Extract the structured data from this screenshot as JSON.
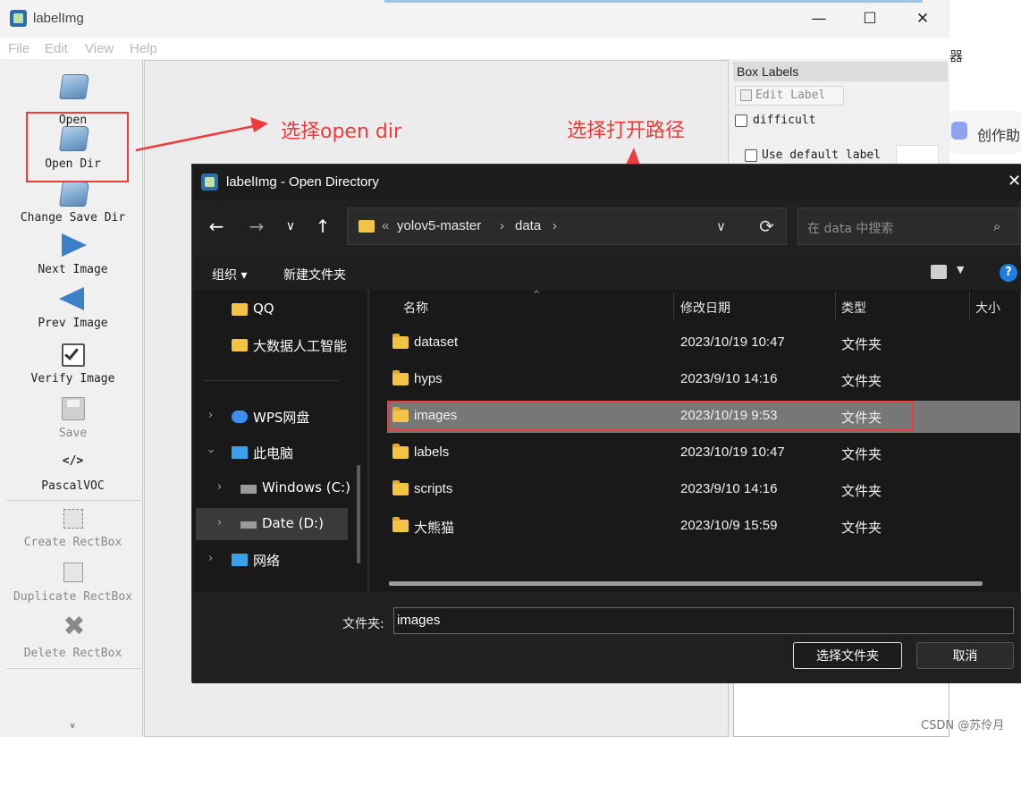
{
  "window": {
    "title": "labelImg",
    "controls": {
      "minimize": "—",
      "maximize": "☐",
      "close": "✕"
    }
  },
  "menu": [
    "File",
    "Edit",
    "View",
    "Help"
  ],
  "toolbar": {
    "open": "Open",
    "open_dir": "Open Dir",
    "change_save_dir": "Change Save Dir",
    "next_image": "Next Image",
    "prev_image": "Prev Image",
    "verify_image": "Verify Image",
    "save": "Save",
    "format_icon": "</>",
    "pascal_voc": "PascalVOC",
    "create_rectbox": "Create RectBox",
    "duplicate_rectbox": "Duplicate RectBox",
    "delete_rectbox": "Delete RectBox",
    "more": "»"
  },
  "box_labels": {
    "title": "Box Labels",
    "edit_label": "Edit Label",
    "difficult": "difficult",
    "use_default_label": "Use default label"
  },
  "annotations": {
    "open_dir_note": "选择open dir",
    "path_note": "选择打开路径"
  },
  "background_peek": {
    "fragment1": "器",
    "fragment2": "创作助"
  },
  "dialog": {
    "title": "labelImg - Open Directory",
    "nav": {
      "back": "←",
      "forward": "→",
      "recent": "∨",
      "up": "↑"
    },
    "address": {
      "sep": "«",
      "crumb1": "yolov5-master",
      "crumb2": "data",
      "arrow": "›"
    },
    "search_placeholder": "在 data 中搜索",
    "commands": {
      "organize": "组织 ▾",
      "new_folder": "新建文件夹",
      "help": "?"
    },
    "sidebar": [
      {
        "label": "QQ"
      },
      {
        "label": "大数据人工智能"
      },
      {
        "label": "WPS网盘"
      },
      {
        "label": "此电脑"
      },
      {
        "label": "Windows (C:)"
      },
      {
        "label": "Date (D:)"
      },
      {
        "label": "网络"
      }
    ],
    "columns": {
      "name": "名称",
      "modified": "修改日期",
      "type": "类型",
      "size": "大小"
    },
    "files": [
      {
        "name": "dataset",
        "modified": "2023/10/19 10:47",
        "type": "文件夹"
      },
      {
        "name": "hyps",
        "modified": "2023/9/10 14:16",
        "type": "文件夹"
      },
      {
        "name": "images",
        "modified": "2023/10/19 9:53",
        "type": "文件夹"
      },
      {
        "name": "labels",
        "modified": "2023/10/19 10:47",
        "type": "文件夹"
      },
      {
        "name": "scripts",
        "modified": "2023/9/10 14:16",
        "type": "文件夹"
      },
      {
        "name": "大熊猫",
        "modified": "2023/10/9 15:59",
        "type": "文件夹"
      }
    ],
    "folder_label": "文件夹:",
    "folder_value": "images",
    "select_button": "选择文件夹",
    "cancel_button": "取消"
  },
  "watermark": "CSDN @苏伶月",
  "colors": {
    "annotation": "#ef3b3b",
    "dialog_bg": "#202020",
    "selected_row": "#777777"
  }
}
